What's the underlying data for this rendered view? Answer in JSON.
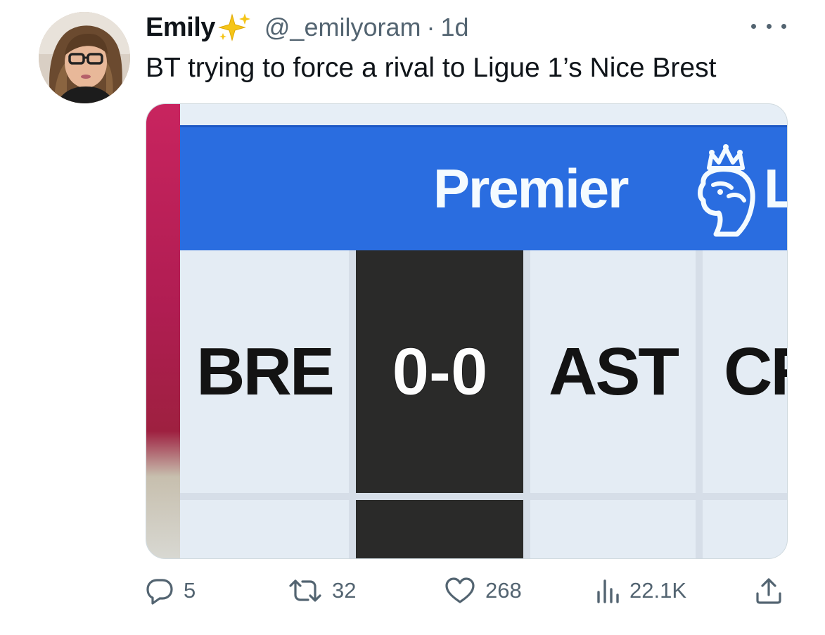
{
  "tweet": {
    "display_name": "Emily",
    "handle": "@_emilyoram",
    "separator": "·",
    "time": "1d",
    "text": "BT trying to force a rival to Ligue 1’s Nice Brest"
  },
  "media": {
    "banner_text": "Premier",
    "banner_text_cut": "Le",
    "cells": [
      "BRE",
      "0-0",
      "AST",
      "CR"
    ]
  },
  "actions": {
    "reply_count": "5",
    "retweet_count": "32",
    "like_count": "268",
    "views_count": "22.1K"
  },
  "icons": {
    "verified_badge": "sparkle-icon",
    "more": "more-icon",
    "reply": "reply-icon",
    "retweet": "retweet-icon",
    "like": "heart-icon",
    "views": "views-icon",
    "share": "share-icon"
  },
  "colors": {
    "accent_blue": "#2a6de0",
    "text_secondary": "#536471",
    "sparkle_yellow": "#f5c518"
  }
}
